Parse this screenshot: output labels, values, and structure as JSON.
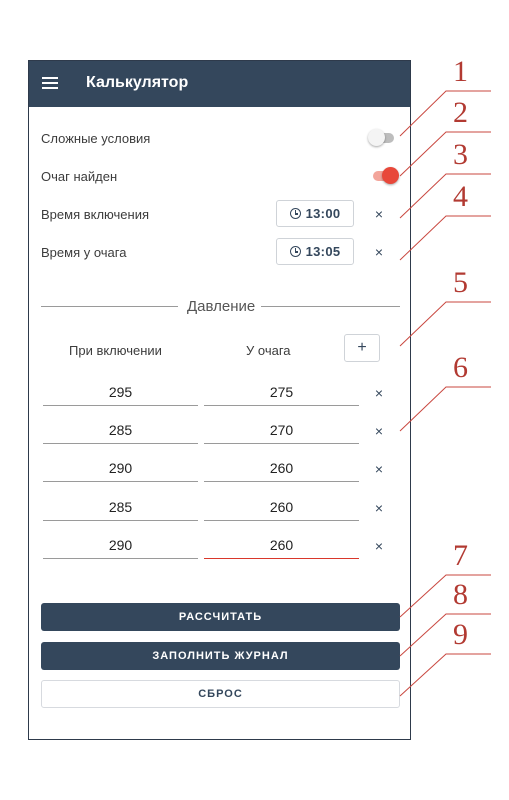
{
  "app": {
    "title": "Калькулятор"
  },
  "settings": {
    "complex_conditions": {
      "label": "Сложные условия",
      "on": false
    },
    "fire_found": {
      "label": "Очаг найден",
      "on": true
    },
    "start_time": {
      "label": "Время включения",
      "value": "13:00"
    },
    "fire_time": {
      "label": "Время у очага",
      "value": "13:05"
    }
  },
  "pressure": {
    "section_title": "Давление",
    "col_start": "При включении",
    "col_fire": "У очага",
    "add_label": "+",
    "remove_label": "×",
    "rows": [
      {
        "start": "295",
        "fire": "275"
      },
      {
        "start": "285",
        "fire": "270"
      },
      {
        "start": "290",
        "fire": "260"
      },
      {
        "start": "285",
        "fire": "260"
      },
      {
        "start": "290",
        "fire": "260"
      }
    ]
  },
  "actions": {
    "calculate": "РАССЧИТАТЬ",
    "fill_log": "ЗАПОЛНИТЬ ЖУРНАЛ",
    "reset": "СБРОС"
  },
  "annotations": [
    "1",
    "2",
    "3",
    "4",
    "5",
    "6",
    "7",
    "8",
    "9"
  ],
  "colors": {
    "primary": "#34475c",
    "accent": "#e8483a",
    "annotation": "#b23a32"
  }
}
